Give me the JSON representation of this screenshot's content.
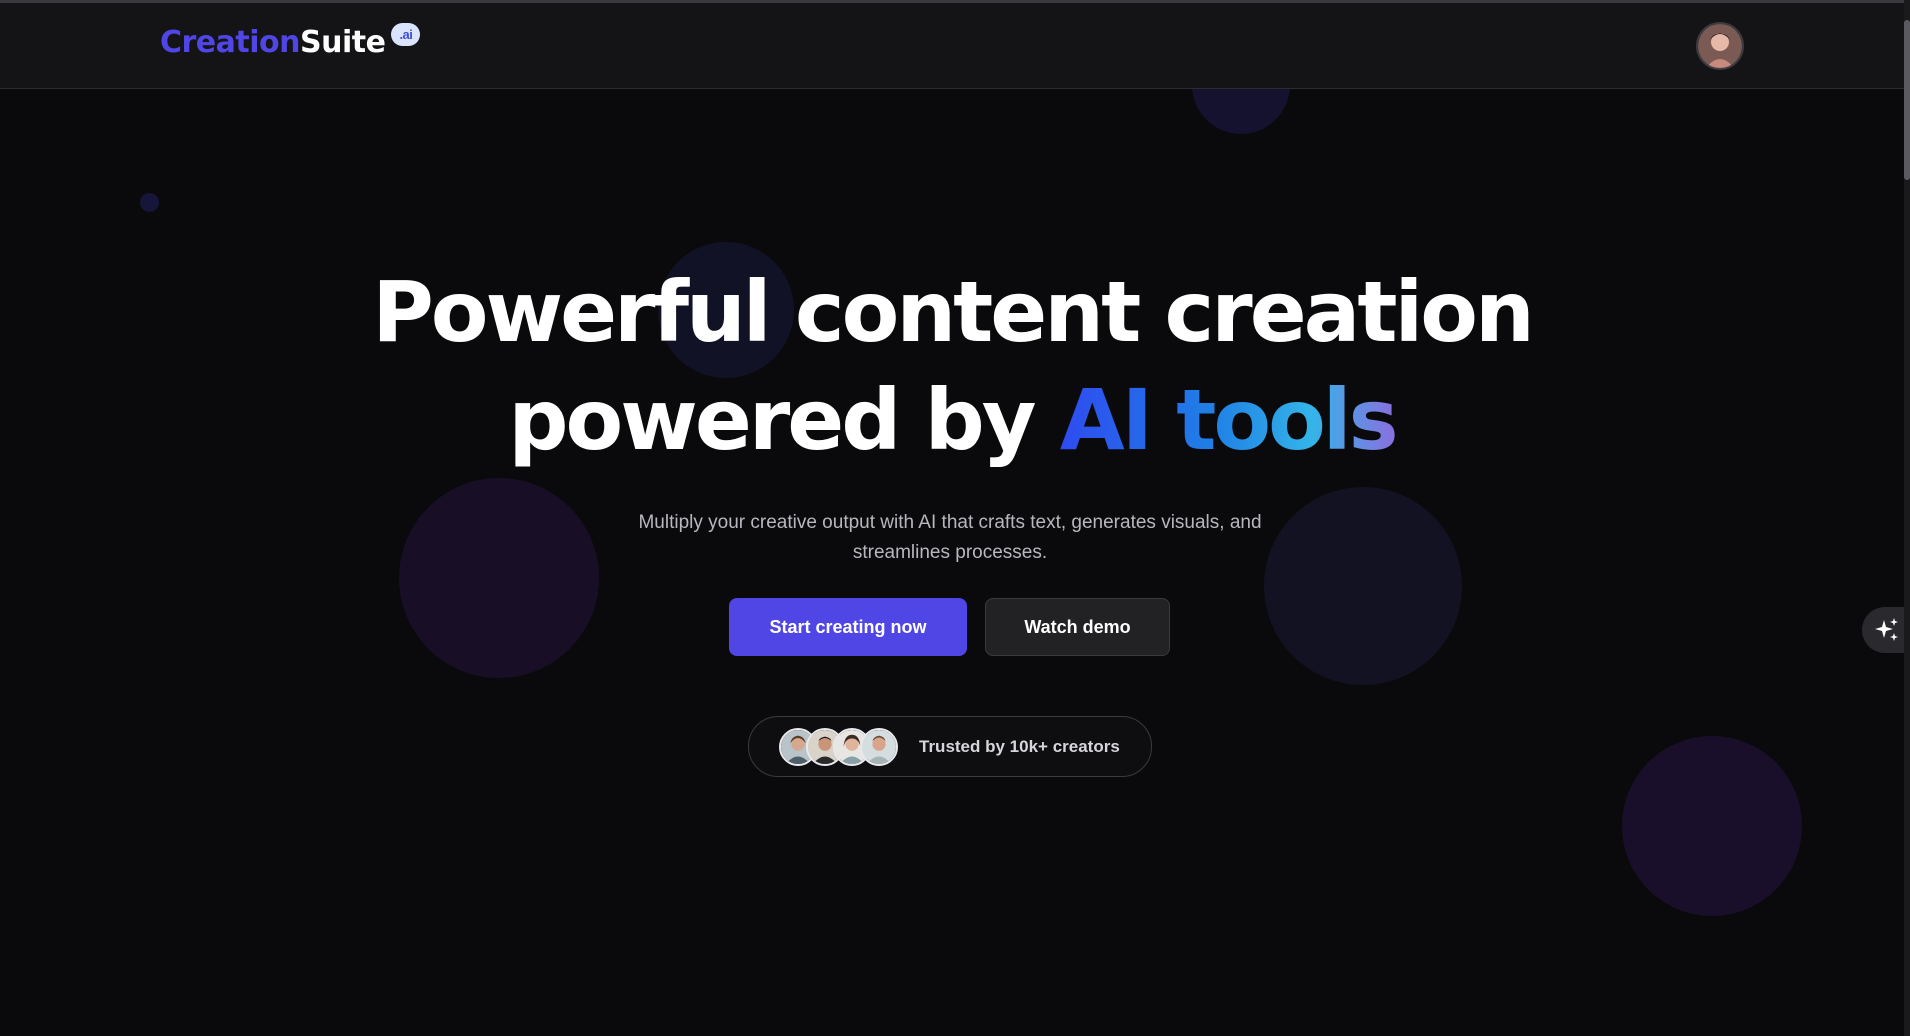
{
  "brand": {
    "name_part1": "Creation",
    "name_part2": "Suite",
    "badge": ".ai"
  },
  "header": {
    "avatar_icon": "user-avatar"
  },
  "hero": {
    "title_line1": "Powerful content creation",
    "title_line2_plain": "powered by ",
    "title_line2_highlight": "AI tools",
    "subtitle": "Multiply your creative output with AI that crafts text, generates visuals, and streamlines processes."
  },
  "actions": {
    "primary_label": "Start creating now",
    "secondary_label": "Watch demo"
  },
  "trust": {
    "text": "Trusted by 10k+ creators",
    "avatars": [
      "creator-avatar-1",
      "creator-avatar-2",
      "creator-avatar-3",
      "creator-avatar-4"
    ]
  },
  "colors": {
    "accent": "#4f46e5",
    "background": "#0a0a0c",
    "header": "#141416"
  },
  "floating": {
    "icon": "sparkle-icon"
  }
}
